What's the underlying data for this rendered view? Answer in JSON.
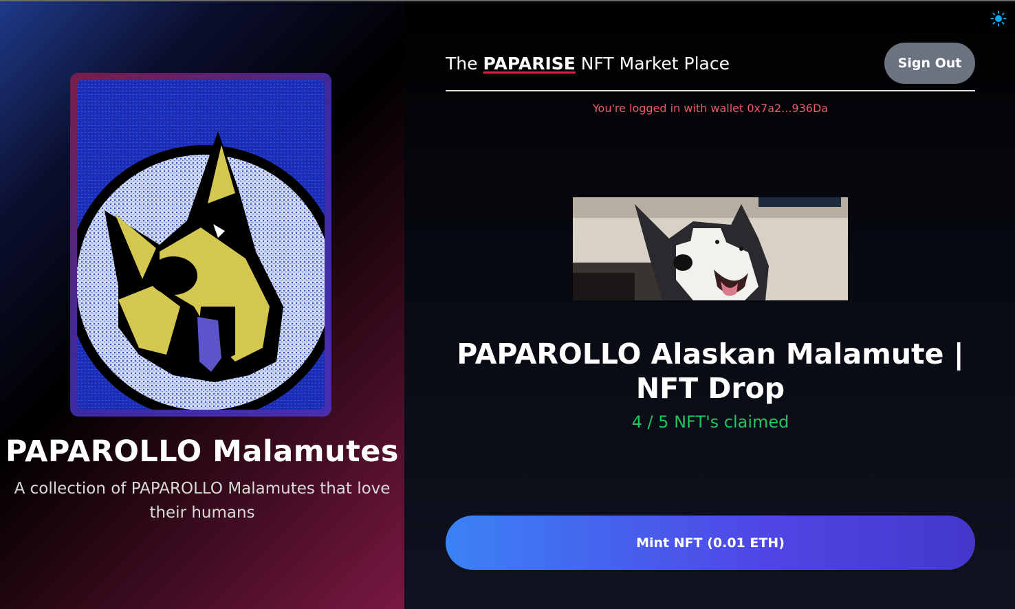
{
  "collection": {
    "title": "PAPAROLLO Malamutes",
    "description": "A collection of PAPAROLLO Malamutes that love their humans"
  },
  "header": {
    "title_prefix": "The ",
    "brand": "PAPARISE",
    "title_suffix": " NFT Market Place",
    "signout_label": "Sign Out"
  },
  "wallet": {
    "status": "You're logged in with wallet 0x7a2...936Da"
  },
  "drop": {
    "title": "PAPAROLLO Alaskan Malamute | NFT Drop",
    "claimed_text": "4 / 5 NFT's claimed",
    "claimed": 4,
    "total": 5
  },
  "mint": {
    "label": "Mint NFT (0.01 ETH)"
  },
  "colors": {
    "accent": "#4f46e5",
    "status_red": "#f05a6a",
    "status_green": "#22c55e",
    "signout_bg": "#6b7280",
    "theme_icon": "#0ea5e9"
  },
  "icons": {
    "theme_toggle": "sun-icon"
  }
}
